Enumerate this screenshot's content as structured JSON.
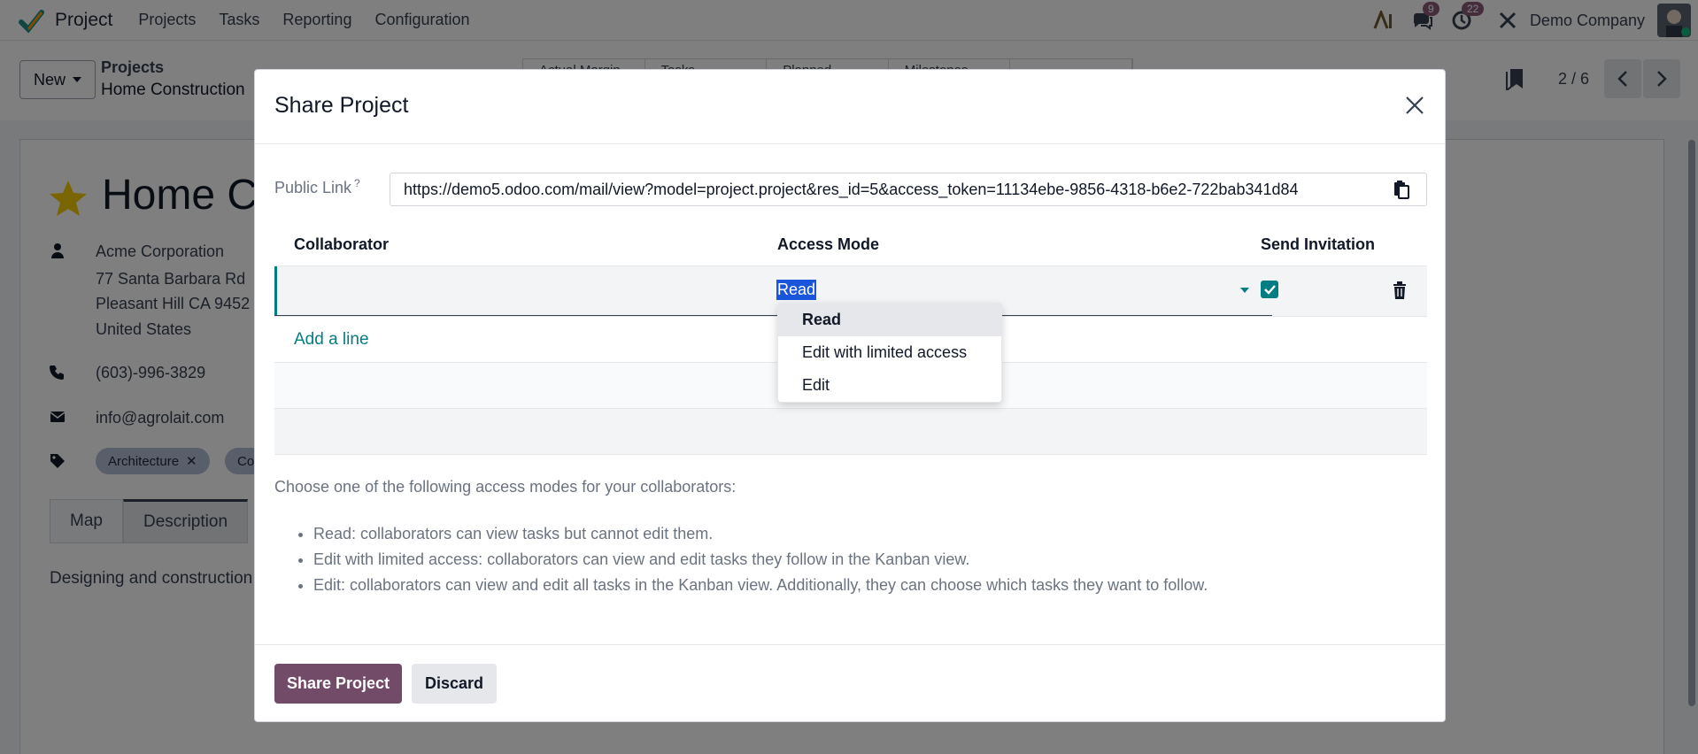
{
  "navbar": {
    "app_name": "Project",
    "menu": [
      "Projects",
      "Tasks",
      "Reporting",
      "Configuration"
    ],
    "messages_count": "9",
    "activities_count": "22",
    "company": "Demo Company"
  },
  "control_panel": {
    "new_label": "New",
    "breadcrumb_parent": "Projects",
    "breadcrumb_current": "Home Construction",
    "stat_buttons": [
      "Actual Margin",
      "Tasks",
      "Planned",
      "Milestones",
      ""
    ],
    "pager": "2 / 6"
  },
  "record": {
    "title": "Home Co",
    "customer": "Acme Corporation",
    "address_1": "77 Santa Barbara Rd",
    "address_2": "Pleasant Hill CA 9452",
    "country": "United States",
    "phone": "(603)-996-3829",
    "email": "info@agrolait.com",
    "tags": [
      "Architecture",
      "Co"
    ],
    "tabs": [
      "Map",
      "Description"
    ],
    "description": "Designing and construction"
  },
  "modal": {
    "title": "Share Project",
    "public_link_label": "Public Link",
    "public_link_help": "?",
    "public_link_value": "https://demo5.odoo.com/mail/view?model=project.project&res_id=5&access_token=11134ebe-9856-4318-b6e2-722bab341d84",
    "columns": {
      "collaborator": "Collaborator",
      "access_mode": "Access Mode",
      "send_invitation": "Send Invitation"
    },
    "row": {
      "collaborator": "",
      "access_mode": "Read",
      "send_invitation": true
    },
    "add_line": "Add a line",
    "access_options": [
      "Read",
      "Edit with limited access",
      "Edit"
    ],
    "help_intro": "Choose one of the following access modes for your collaborators:",
    "help_items": [
      "Read: collaborators can view tasks but cannot edit them.",
      "Edit with limited access: collaborators can view and edit tasks they follow in the Kanban view.",
      "Edit: collaborators can view and edit all tasks in the Kanban view. Additionally, they can choose which tasks they want to follow."
    ],
    "share_button": "Share Project",
    "discard_button": "Discard"
  },
  "colors": {
    "primary": "#714b67",
    "accent": "#017e84",
    "selection": "#1a56db"
  }
}
